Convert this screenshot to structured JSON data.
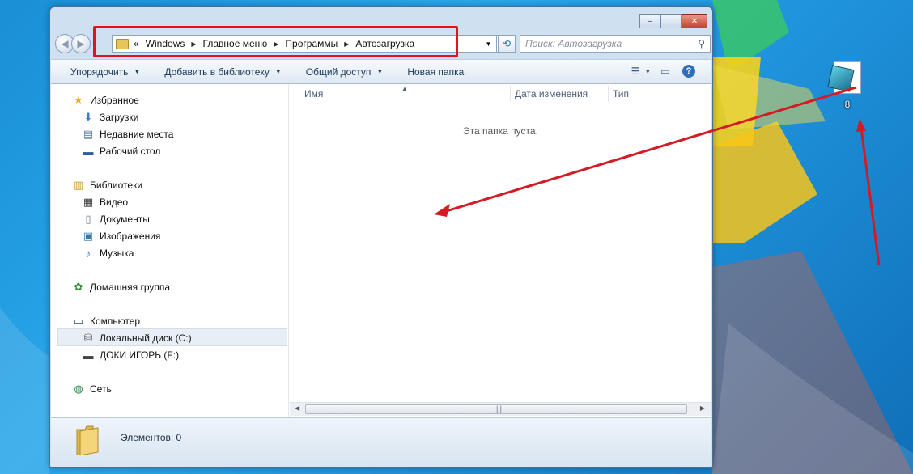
{
  "window": {
    "controls": {
      "minimize": "‒",
      "maximize": "□",
      "close": "✕"
    }
  },
  "address": {
    "prefix": "«",
    "crumbs": [
      "Windows",
      "Главное меню",
      "Программы",
      "Автозагрузка"
    ],
    "search_placeholder": "Поиск: Автозагрузка"
  },
  "toolbar": {
    "organize": "Упорядочить",
    "add_to_library": "Добавить в библиотеку",
    "share": "Общий доступ",
    "new_folder": "Новая папка"
  },
  "nav": {
    "favorites": "Избранное",
    "downloads": "Загрузки",
    "recent": "Недавние места",
    "desktop": "Рабочий стол",
    "libraries": "Библиотеки",
    "video": "Видео",
    "documents": "Документы",
    "images": "Изображения",
    "music": "Музыка",
    "homegroup": "Домашняя группа",
    "computer": "Компьютер",
    "local_disk": "Локальный диск (C:)",
    "usb_drive": "ДОКИ ИГОРЬ (F:)",
    "network": "Сеть"
  },
  "columns": {
    "name": "Имя",
    "date_modified": "Дата изменения",
    "type": "Тип"
  },
  "content": {
    "empty": "Эта папка пуста."
  },
  "status": {
    "items": "Элементов: 0"
  },
  "desktop_icon": {
    "label": "8"
  },
  "colors": {
    "highlight": "#e0141c",
    "arrow": "#d41a22"
  }
}
